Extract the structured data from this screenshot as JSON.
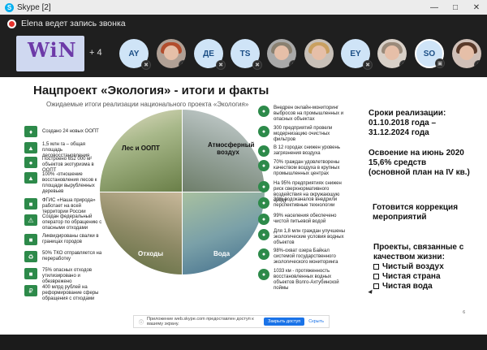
{
  "window": {
    "title": "Skype [2]"
  },
  "recording": {
    "text": "Elena ведет запись звонка"
  },
  "participants": {
    "logo_text": "WiN",
    "extra_count": "+ 4",
    "avatars": [
      {
        "initials": "AY"
      },
      {
        "initials": ""
      },
      {
        "initials": "ДЕ"
      },
      {
        "initials": "TS"
      },
      {
        "initials": ""
      },
      {
        "initials": ""
      },
      {
        "initials": "EY"
      },
      {
        "initials": ""
      },
      {
        "initials": "SO"
      },
      {
        "initials": ""
      }
    ]
  },
  "slide": {
    "title": "Нацпроект «Экология» - итоги и факты",
    "subtitle": "Ожидаемые итоги реализации национального проекта «Экология»",
    "left_items": [
      "Создано 24 новых ООПТ",
      "1,5 млн га – общая площадь лесовосстановления",
      "Построено 652 000 м² объектов экотуризма в ООПТ",
      "100% -отношение восстановления лесов к площади вырубленных деревьев",
      "ФГИС «Наша природа» работает на всей территории России",
      "Создан федеральный оператор по обращению с опасными отходами",
      "Ликвидированы свалки в границах городов",
      "50% ТКО отправляется на переработку",
      "75% опасных отходов утилизировано и обезврежено",
      "400 млрд рублей на реформирование сферы обращения с отходами"
    ],
    "right_items": [
      "Внедрен онлайн-мониторинг выбросов на промышленных и опасных объектах",
      "300 предприятий провели модернизацию очистных фильтров",
      "В 12 городах снижен уровень загрязнения воздуха",
      "70% граждан удовлетворены качеством воздуха в крупных промышленных центрах",
      "На 95% предприятиях снижен риск сверхнормативного воздействия на окружающую среду",
      "30% водоканалов внедрили перспективные технологии",
      "99% населения обеспечено чистой питьевой водой",
      "Для 1,8 млн граждан улучшены экологические условия водных объектов",
      "98%-охват озера Байкал системой государственного экологического мониторинга",
      "1033 км - протяженность восстановленных водных объектов Волго-Ахтубинской поймы"
    ],
    "quadrants": {
      "top_left": "Лес и ООПТ",
      "top_right": "Атмосферный воздух",
      "bottom_left": "Отходы",
      "bottom_right": "Вода"
    },
    "right_panel": {
      "dates_label": "Сроки реализации:",
      "dates_value": "01.10.2018 года –",
      "dates_value2": "31.12.2024 года",
      "funding_1": "Освоение на июнь 2020",
      "funding_2": "15,6% средств",
      "funding_3": "(основной план на IV кв.)",
      "correction_1": "Готовится коррекция",
      "correction_2": "мероприятий",
      "projects_1": "Проекты, связанные с",
      "projects_2": "качеством жизни:",
      "projects": [
        "Чистый воздух",
        "Чистая страна",
        "Чистая вода"
      ]
    },
    "page_number": "6"
  },
  "share_prompt": {
    "message": "Приложение web.skype.com предоставлен доступ к вашему экрану.",
    "stop_label": "Закрыть доступ",
    "hide_label": "Скрыть"
  }
}
